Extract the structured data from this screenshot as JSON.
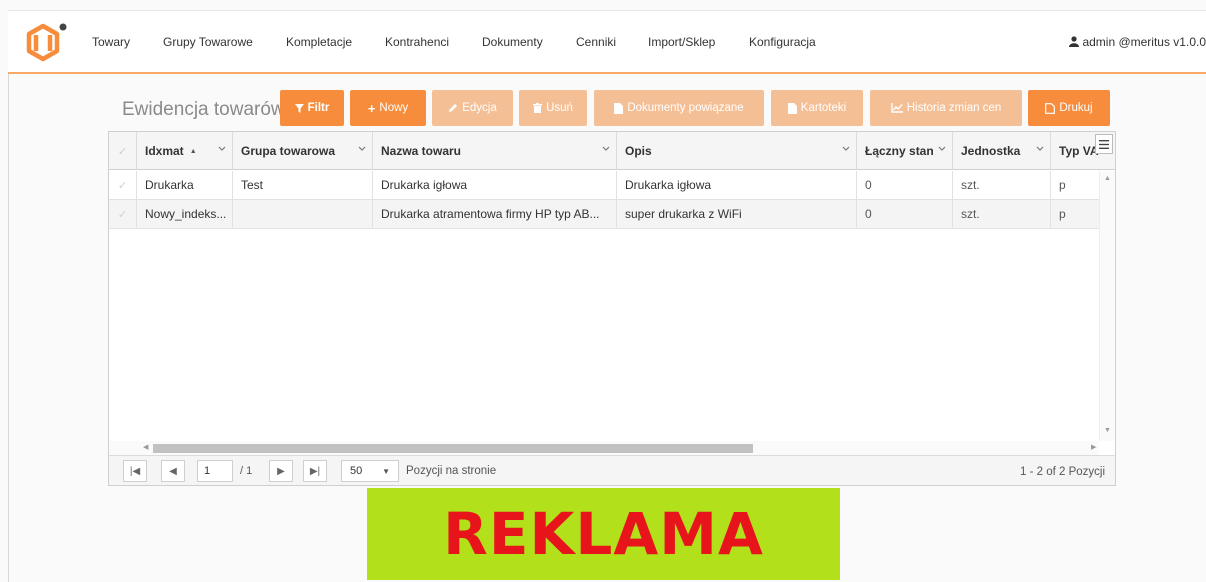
{
  "nav": {
    "items": [
      "Towary",
      "Grupy Towarowe",
      "Kompletacje",
      "Kontrahenci",
      "Dokumenty",
      "Cenniki",
      "Import/Sklep",
      "Konfiguracja"
    ],
    "user": "admin @meritus v1.0.0",
    "accent": "#f68c3c"
  },
  "page": {
    "title": "Ewidencja towarów"
  },
  "toolbar": {
    "filter": "Filtr",
    "new": "Nowy",
    "edit": "Edycja",
    "delete": "Usuń",
    "related_docs": "Dokumenty powiązane",
    "cards": "Kartoteki",
    "price_history": "Historia zmian cen",
    "print": "Drukuj"
  },
  "table": {
    "columns": [
      "Idxmat",
      "Grupa towarowa",
      "Nazwa towaru",
      "Opis",
      "Łączny stan",
      "Jednostka",
      "Typ VA"
    ],
    "rows": [
      [
        "Drukarka",
        "Test",
        "Drukarka igłowa",
        "Drukarka igłowa",
        "0",
        "szt.",
        "p"
      ],
      [
        "Nowy_indeks...",
        "",
        "Drukarka atramentowa firmy HP typ AB...",
        "super drukarka z WiFi",
        "0",
        "szt.",
        "p"
      ]
    ]
  },
  "pager": {
    "page": "1",
    "total": "/ 1",
    "page_size": "50",
    "per_page_label": "Pozycji na stronie",
    "range": "1 - 2 of 2 Pozycji"
  },
  "ad": {
    "text": "REKLAMA"
  }
}
